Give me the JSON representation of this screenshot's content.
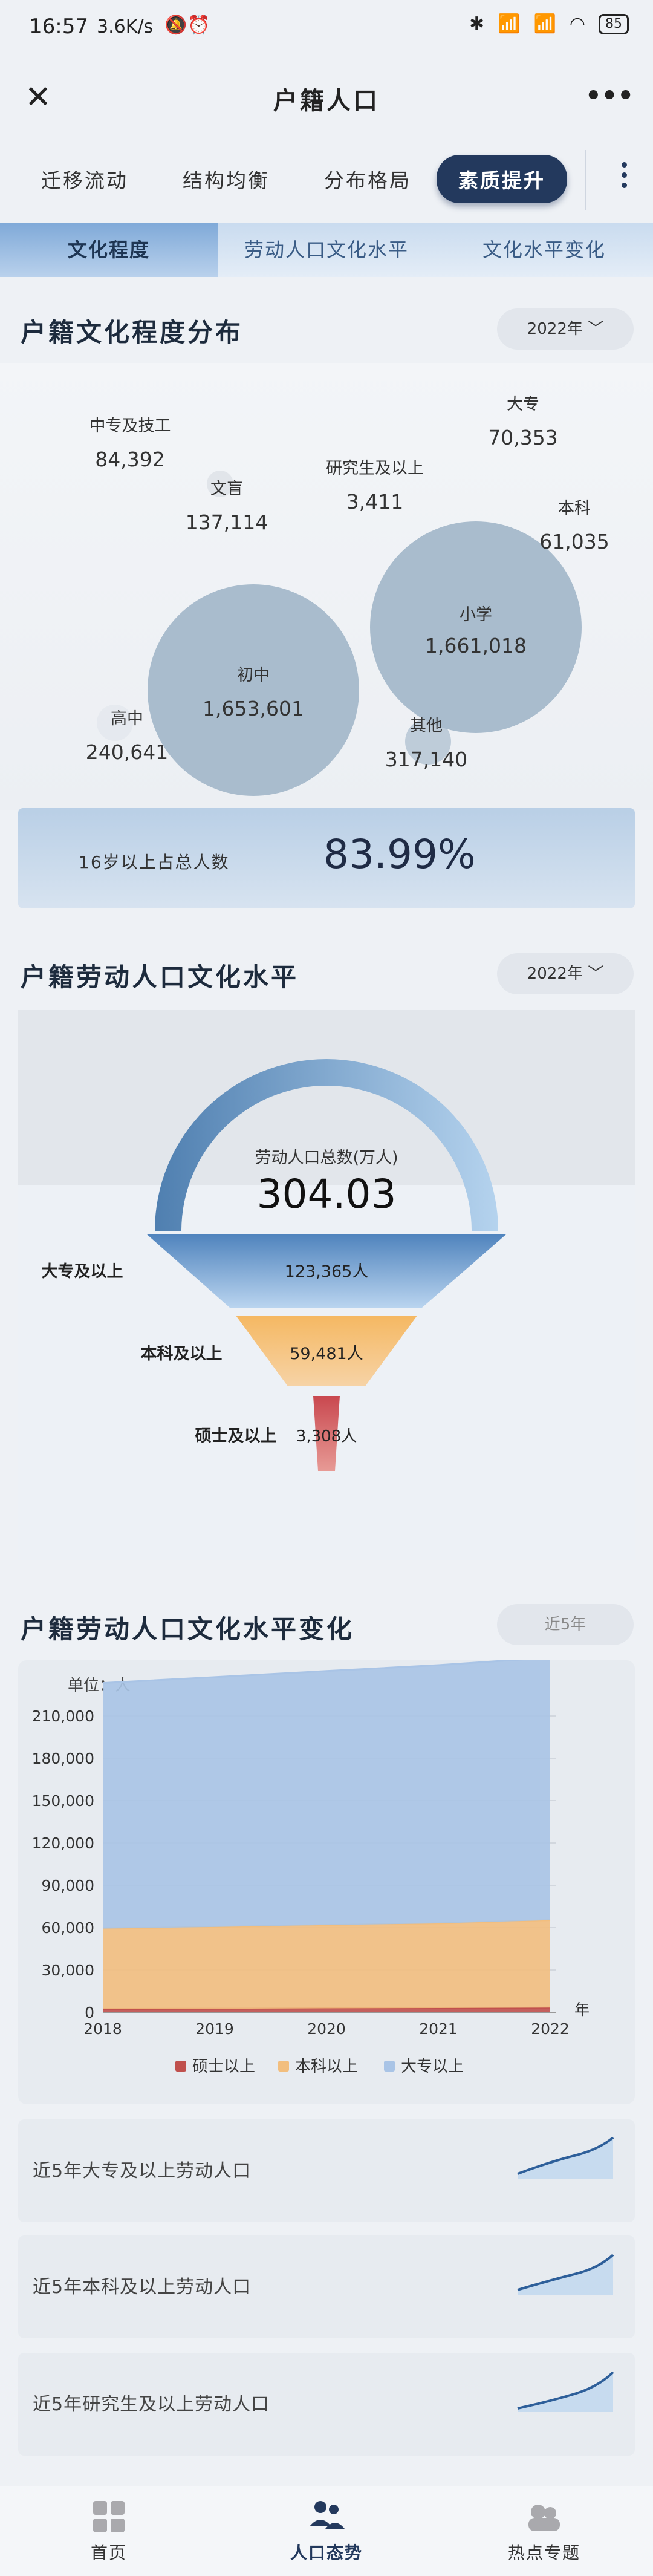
{
  "status": {
    "time": "16:57",
    "speed": "3.6K/s",
    "battery": "85"
  },
  "header": {
    "title": "户籍人口"
  },
  "top_tabs": [
    {
      "label": "迁移流动"
    },
    {
      "label": "结构均衡"
    },
    {
      "label": "分布格局"
    },
    {
      "label": "素质提升"
    }
  ],
  "sub_tabs": [
    {
      "label": "文化程度"
    },
    {
      "label": "劳动人口文化水平"
    },
    {
      "label": "文化水平变化"
    }
  ],
  "section1": {
    "title": "户籍文化程度分布",
    "year": "2022年",
    "bubbles": [
      {
        "label": "中专及技工",
        "value": "84,392"
      },
      {
        "label": "文盲",
        "value": "137,114"
      },
      {
        "label": "研究生及以上",
        "value": "3,411"
      },
      {
        "label": "大专",
        "value": "70,353"
      },
      {
        "label": "本科",
        "value": "61,035"
      },
      {
        "label": "小学",
        "value": "1,661,018"
      },
      {
        "label": "初中",
        "value": "1,653,601"
      },
      {
        "label": "高中",
        "value": "240,641"
      },
      {
        "label": "其他",
        "value": "317,140"
      }
    ],
    "ratio": {
      "label": "16岁以上占总人数",
      "value": "83.99%"
    }
  },
  "section2": {
    "title": "户籍劳动人口文化水平",
    "year": "2022年",
    "total_label": "劳动人口总数(万人)",
    "total_value": "304.03",
    "levels": [
      {
        "label": "大专及以上",
        "value": "123,365人"
      },
      {
        "label": "本科及以上",
        "value": "59,481人"
      },
      {
        "label": "硕士及以上",
        "value": "3,308人"
      }
    ]
  },
  "section3": {
    "title": "户籍劳动人口文化水平变化",
    "range_btn": "近5年",
    "trend_cards": [
      {
        "label": "近5年大专及以上劳动人口"
      },
      {
        "label": "近5年本科及以上劳动人口"
      },
      {
        "label": "近5年研究生及以上劳动人口"
      }
    ]
  },
  "chart_data": {
    "type": "area",
    "unit_label": "单位：人",
    "x_unit": "年",
    "x": [
      "2018",
      "2019",
      "2020",
      "2021",
      "2022"
    ],
    "ylim": [
      0,
      210000
    ],
    "yticks": [
      "0",
      "30,000",
      "60,000",
      "90,000",
      "120,000",
      "150,000",
      "180,000",
      "210,000"
    ],
    "series": [
      {
        "name": "硕士以上",
        "color": "#c0504d",
        "values": [
          2300,
          2500,
          2800,
          3000,
          3300
        ]
      },
      {
        "name": "本科以上",
        "color": "#f2be7e",
        "values": [
          57000,
          58000,
          59000,
          60000,
          62000
        ]
      },
      {
        "name": "大专以上",
        "color": "#a9c4e6",
        "values": [
          174000,
          177000,
          180000,
          183000,
          186000
        ]
      }
    ]
  },
  "bottom_nav": [
    {
      "label": "首页"
    },
    {
      "label": "人口态势"
    },
    {
      "label": "热点专题"
    }
  ]
}
